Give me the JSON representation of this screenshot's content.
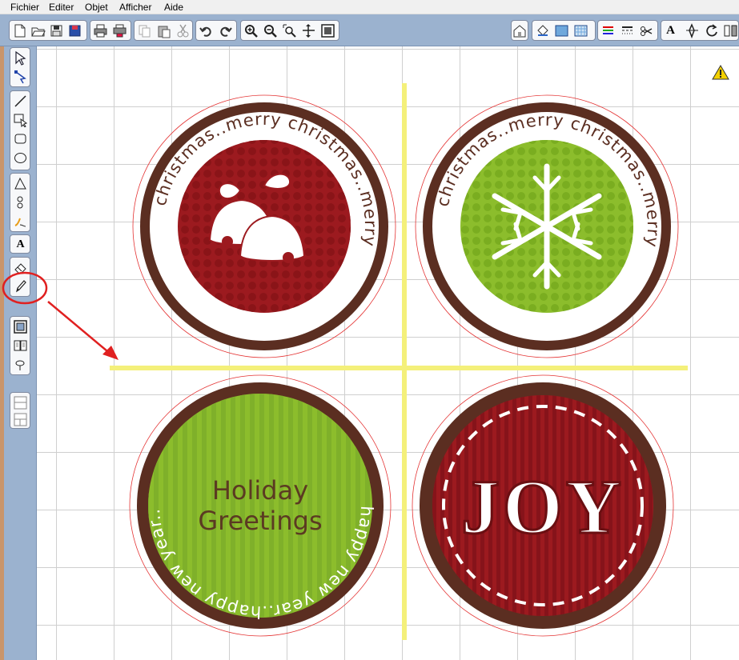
{
  "menu": {
    "items": [
      "Fichier",
      "Editer",
      "Objet",
      "Afficher",
      "Aide"
    ]
  },
  "toolbar": {
    "text_tool_glyph": "A"
  },
  "leftbar": {
    "text_tool_glyph": "A"
  },
  "stickers": {
    "top_left": {
      "ring_text": "christmas..merry christmas..merry",
      "center_color": "#9c1a1f",
      "icon": "bells-icon"
    },
    "top_right": {
      "ring_text": "christmas..merry christmas..merry",
      "center_color": "#8cbd2c",
      "icon": "snowflake-icon"
    },
    "bottom_left": {
      "ring_text": "happy new year..happy new year..",
      "line1": "Holiday",
      "line2": "Greetings",
      "center_color": "#8cbd2c"
    },
    "bottom_right": {
      "title": "JOY",
      "center_color": "#9c1a1f"
    }
  },
  "colors": {
    "toolbar_bg": "#9bb2cf",
    "brown_ring": "#5b2e21",
    "guide_yellow": "#f4f07a",
    "annotation_red": "#e02020",
    "warning_yellow": "#f3d000"
  },
  "icons": {
    "warning": "warning-icon",
    "pencil": "pencil-icon"
  }
}
